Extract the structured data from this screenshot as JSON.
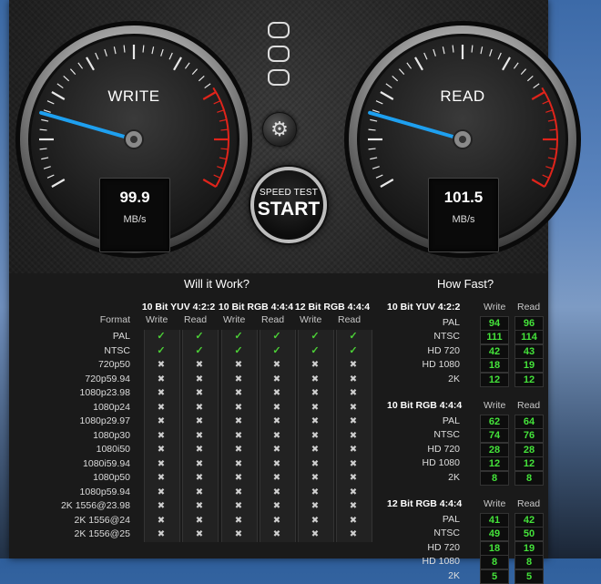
{
  "write_gauge": {
    "label": "WRITE",
    "value": "99.9",
    "unit": "MB/s"
  },
  "read_gauge": {
    "label": "READ",
    "value": "101.5",
    "unit": "MB/s"
  },
  "start_button": {
    "line1": "SPEED TEST",
    "line2": "START"
  },
  "icons": {
    "settings": "gear-icon",
    "window_controls": "traffic-light-pills"
  },
  "colors": {
    "needle": "#1ea0f0",
    "redline": "#e0241b",
    "pass": "#4cd137",
    "speed": "#44e23a"
  },
  "will_it_work": {
    "title": "Will it Work?",
    "format_label": "Format",
    "groups": [
      "10 Bit YUV 4:2:2",
      "10 Bit RGB 4:4:4",
      "12 Bit RGB 4:4:4"
    ],
    "write_label": "Write",
    "read_label": "Read",
    "rows": [
      {
        "format": "PAL",
        "res": [
          "yes",
          "yes",
          "yes",
          "yes",
          "yes",
          "yes"
        ]
      },
      {
        "format": "NTSC",
        "res": [
          "yes",
          "yes",
          "yes",
          "yes",
          "yes",
          "yes"
        ]
      },
      {
        "format": "720p50",
        "res": [
          "no",
          "no",
          "no",
          "no",
          "no",
          "no"
        ]
      },
      {
        "format": "720p59.94",
        "res": [
          "no",
          "no",
          "no",
          "no",
          "no",
          "no"
        ]
      },
      {
        "format": "1080p23.98",
        "res": [
          "no",
          "no",
          "no",
          "no",
          "no",
          "no"
        ]
      },
      {
        "format": "1080p24",
        "res": [
          "no",
          "no",
          "no",
          "no",
          "no",
          "no"
        ]
      },
      {
        "format": "1080p29.97",
        "res": [
          "no",
          "no",
          "no",
          "no",
          "no",
          "no"
        ]
      },
      {
        "format": "1080p30",
        "res": [
          "no",
          "no",
          "no",
          "no",
          "no",
          "no"
        ]
      },
      {
        "format": "1080i50",
        "res": [
          "no",
          "no",
          "no",
          "no",
          "no",
          "no"
        ]
      },
      {
        "format": "1080i59.94",
        "res": [
          "no",
          "no",
          "no",
          "no",
          "no",
          "no"
        ]
      },
      {
        "format": "1080p50",
        "res": [
          "no",
          "no",
          "no",
          "no",
          "no",
          "no"
        ]
      },
      {
        "format": "1080p59.94",
        "res": [
          "no",
          "no",
          "no",
          "no",
          "no",
          "no"
        ]
      },
      {
        "format": "2K 1556@23.98",
        "res": [
          "no",
          "no",
          "no",
          "no",
          "no",
          "no"
        ]
      },
      {
        "format": "2K 1556@24",
        "res": [
          "no",
          "no",
          "no",
          "no",
          "no",
          "no"
        ]
      },
      {
        "format": "2K 1556@25",
        "res": [
          "no",
          "no",
          "no",
          "no",
          "no",
          "no"
        ]
      }
    ]
  },
  "how_fast": {
    "title": "How Fast?",
    "write_label": "Write",
    "read_label": "Read",
    "groups": [
      {
        "name": "10 Bit YUV 4:2:2",
        "rows": [
          {
            "format": "PAL",
            "write": "94",
            "read": "96"
          },
          {
            "format": "NTSC",
            "write": "111",
            "read": "114"
          },
          {
            "format": "HD 720",
            "write": "42",
            "read": "43"
          },
          {
            "format": "HD 1080",
            "write": "18",
            "read": "19"
          },
          {
            "format": "2K",
            "write": "12",
            "read": "12"
          }
        ]
      },
      {
        "name": "10 Bit RGB 4:4:4",
        "rows": [
          {
            "format": "PAL",
            "write": "62",
            "read": "64"
          },
          {
            "format": "NTSC",
            "write": "74",
            "read": "76"
          },
          {
            "format": "HD 720",
            "write": "28",
            "read": "28"
          },
          {
            "format": "HD 1080",
            "write": "12",
            "read": "12"
          },
          {
            "format": "2K",
            "write": "8",
            "read": "8"
          }
        ]
      },
      {
        "name": "12 Bit RGB 4:4:4",
        "rows": [
          {
            "format": "PAL",
            "write": "41",
            "read": "42"
          },
          {
            "format": "NTSC",
            "write": "49",
            "read": "50"
          },
          {
            "format": "HD 720",
            "write": "18",
            "read": "19"
          },
          {
            "format": "HD 1080",
            "write": "8",
            "read": "8"
          },
          {
            "format": "2K",
            "write": "5",
            "read": "5"
          }
        ]
      }
    ]
  }
}
